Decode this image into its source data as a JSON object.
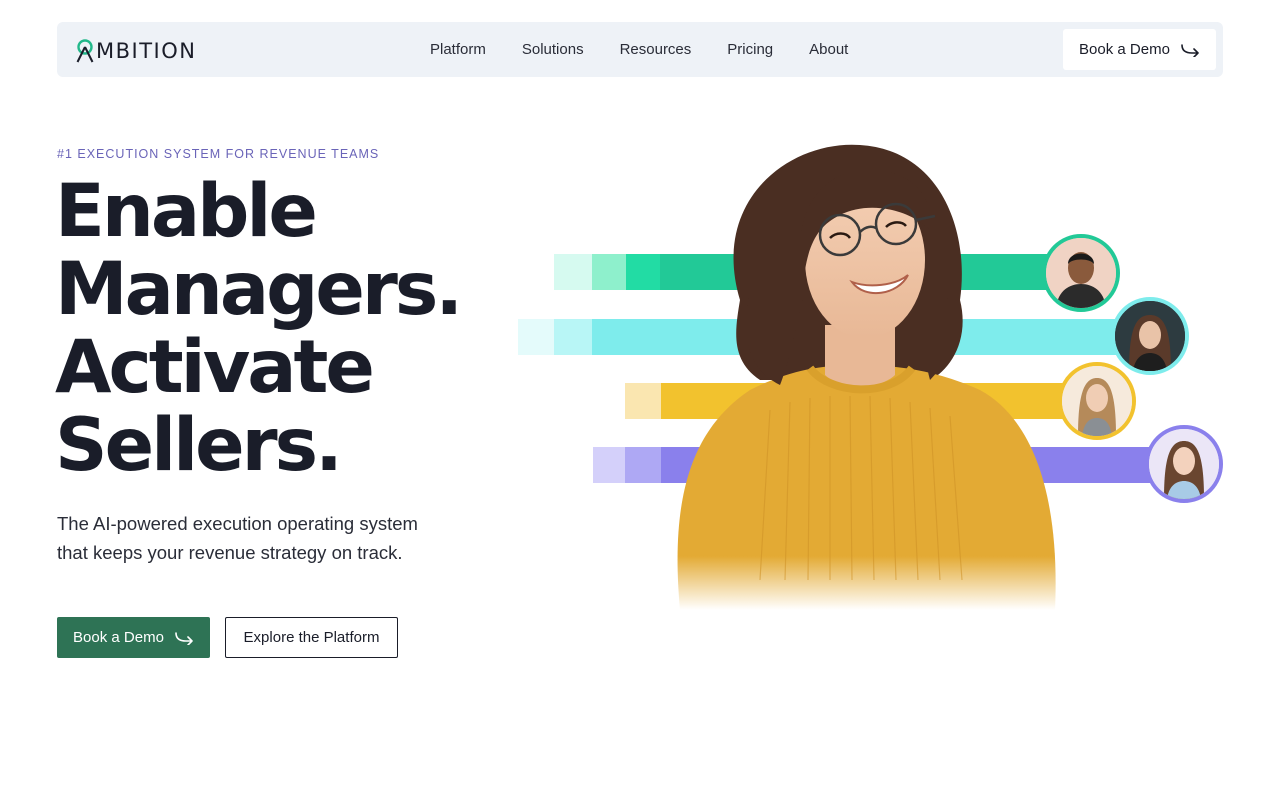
{
  "brand": {
    "name": "MBITION",
    "logo_mark": "ambition-a-logo-icon"
  },
  "nav": {
    "links": [
      "Platform",
      "Solutions",
      "Resources",
      "Pricing",
      "About"
    ],
    "cta_label": "Book a Demo"
  },
  "hero": {
    "eyebrow": "#1 EXECUTION SYSTEM FOR REVENUE TEAMS",
    "headline": [
      "Enable",
      "Managers.",
      "Activate",
      "Sellers."
    ],
    "subtext": "The AI-powered execution operating system that keeps your revenue strategy on track.",
    "primary_cta": "Book a Demo",
    "secondary_cta": "Explore the Platform"
  },
  "colors": {
    "brand_green": "#2e7355",
    "nav_bg": "#eef2f7",
    "eyebrow": "#6a64b8",
    "bar_green": "#22c997",
    "bar_cyan": "#7eecec",
    "bar_yellow": "#f2c22e",
    "bar_purple": "#8a80ec"
  },
  "icons": {
    "arrow": "curved-arrow-right-icon"
  }
}
